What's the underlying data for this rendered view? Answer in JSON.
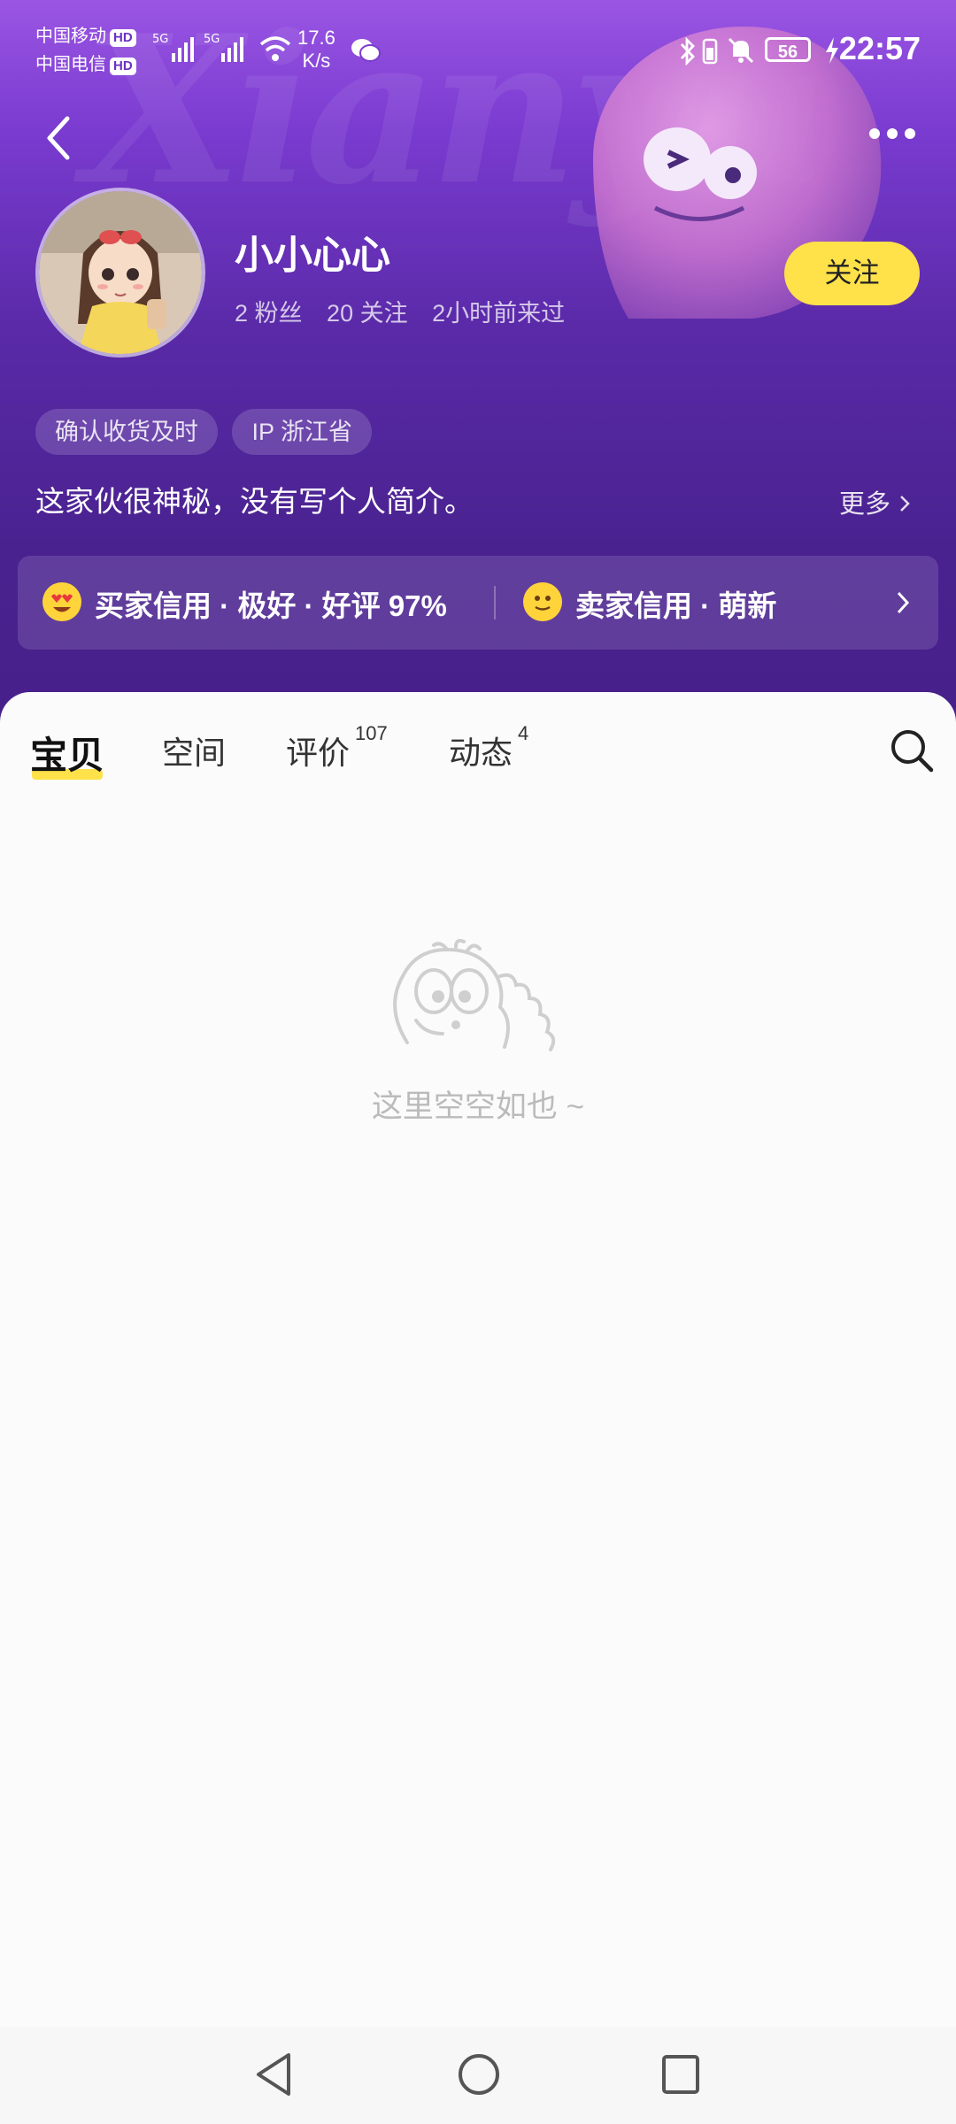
{
  "status_bar": {
    "carrier1": "中国移动",
    "carrier2": "中国电信",
    "hd": "HD",
    "net1": "5G",
    "net2": "5G",
    "speed_value": "17.6",
    "speed_unit": "K/s",
    "battery": "56",
    "time": "22:57"
  },
  "background_text": "Xianyu",
  "profile": {
    "nickname": "小小心心",
    "fans": "2 粉丝",
    "following": "20 关注",
    "last_seen": "2小时前来过",
    "follow_label": "关注"
  },
  "tags": [
    "确认收货及时",
    "IP 浙江省"
  ],
  "bio": {
    "text": "这家伙很神秘，没有写个人简介。",
    "more_label": "更多"
  },
  "credit": {
    "buyer": "买家信用 · 极好 · 好评 97%",
    "seller": "卖家信用 · 萌新"
  },
  "tabs": [
    {
      "label": "宝贝",
      "badge": ""
    },
    {
      "label": "空间",
      "badge": ""
    },
    {
      "label": "评价",
      "badge": "107"
    },
    {
      "label": "动态",
      "badge": "4"
    }
  ],
  "empty_state": {
    "text": "这里空空如也 ~"
  },
  "colors": {
    "accent_yellow": "#ffe14a",
    "header_purple": "#5a2aa8"
  }
}
